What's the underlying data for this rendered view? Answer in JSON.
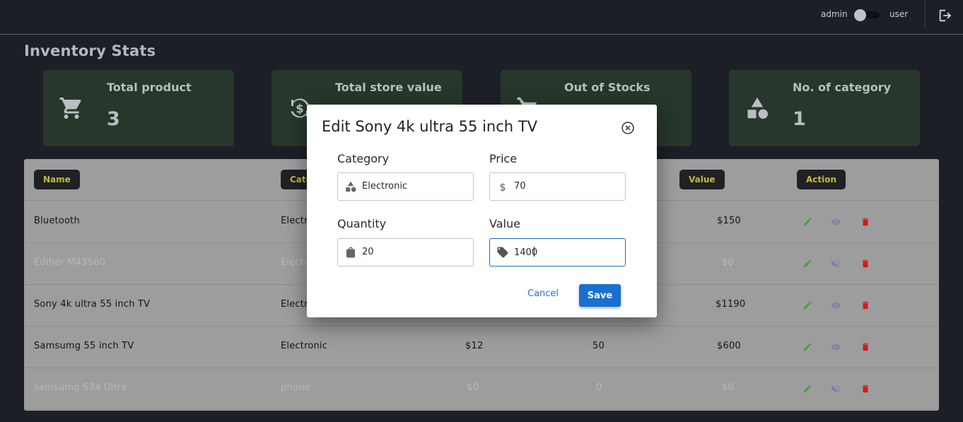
{
  "header": {
    "admin_label": "admin",
    "user_label": "user",
    "logout_icon": "logout-icon"
  },
  "page": {
    "title": "Inventory Stats"
  },
  "cards": [
    {
      "title": "Total product",
      "value": "3",
      "icon": "cart-icon"
    },
    {
      "title": "Total store value",
      "value": "",
      "icon": "currency-exchange-icon"
    },
    {
      "title": "Out of Stocks",
      "value": "",
      "icon": "remove-cart-icon"
    },
    {
      "title": "No. of category",
      "value": "1",
      "icon": "category-icon"
    }
  ],
  "table": {
    "headers": [
      "Name",
      "Cate",
      "Value",
      "Action"
    ],
    "rows": [
      {
        "name": "Bluetooth",
        "category": "Electr",
        "price": "",
        "quantity": "",
        "value": "$150",
        "visible": true
      },
      {
        "name": "Edifier M43560",
        "category": "Electr",
        "price": "",
        "quantity": "",
        "value": "$0",
        "visible": false
      },
      {
        "name": "Sony 4k ultra 55 inch TV",
        "category": "Electr",
        "price": "",
        "quantity": "",
        "value": "$1190",
        "visible": true
      },
      {
        "name": "Samsumg 55 inch TV",
        "category": "Electronic",
        "price": "$12",
        "quantity": "50",
        "value": "$600",
        "visible": true
      },
      {
        "name": "samsumg S34 Ultra",
        "category": "phone",
        "price": "$0",
        "quantity": "0",
        "value": "$0",
        "visible": false
      }
    ]
  },
  "modal": {
    "title": "Edit Sony 4k ultra 55 inch TV",
    "fields": {
      "category": {
        "label": "Category",
        "value": "Electronic"
      },
      "price": {
        "label": "Price",
        "value": "70"
      },
      "quantity": {
        "label": "Quantity",
        "value": "20"
      },
      "value": {
        "label": "Value",
        "value": "1400"
      }
    },
    "cancel_label": "Cancel",
    "save_label": "Save"
  },
  "colors": {
    "background": "#1c1f25",
    "card": "#27372b",
    "header_pill_text": "#c6b93a",
    "primary": "#1a6fd0",
    "edit": "#3aa53a",
    "delete": "#d11a1a"
  }
}
